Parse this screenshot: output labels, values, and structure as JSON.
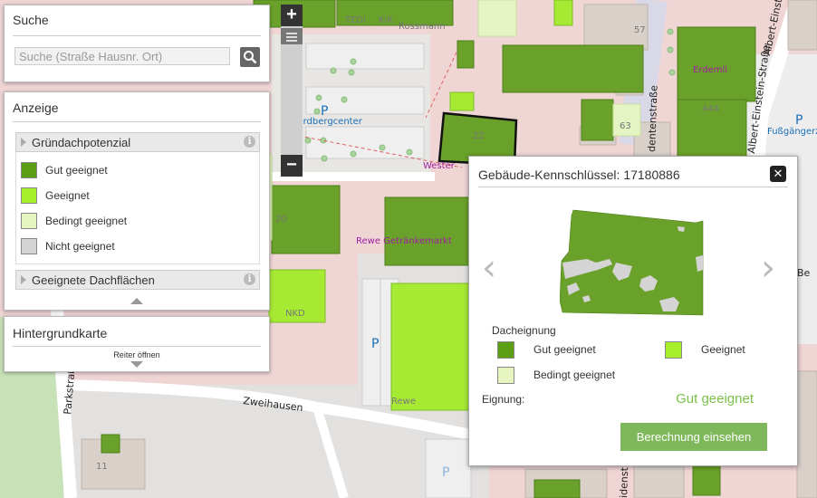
{
  "search": {
    "title": "Suche",
    "placeholder": "Suche (Straße Hausnr. Ort)"
  },
  "display": {
    "title": "Anzeige",
    "layer1": {
      "label": "Gründachpotenzial"
    },
    "legend": [
      {
        "label": "Gut geeignet",
        "color": "#5c9e14"
      },
      {
        "label": "Geeignet",
        "color": "#a6ef2a"
      },
      {
        "label": "Bedingt geeignet",
        "color": "#e6f5c0"
      },
      {
        "label": "Nicht geeignet",
        "color": "#d4d4d4"
      }
    ],
    "layer2": {
      "label": "Geeignete Dachflächen"
    }
  },
  "background": {
    "title": "Hintergrundkarte",
    "open_label": "Reiter öffnen"
  },
  "zoom": {
    "in": "+",
    "out": "−"
  },
  "info": {
    "title": "Gebäude-Kennschlüssel: 17180886",
    "close": "✕",
    "suitability_title": "Dacheignung",
    "legend": [
      {
        "label": "Gut geeignet",
        "color": "#5c9e14"
      },
      {
        "label": "Geeignet",
        "color": "#a6ef2a"
      },
      {
        "label": "Bedingt geeignet",
        "color": "#e6f5c0"
      }
    ],
    "result_label": "Eignung:",
    "result_value": "Gut geeignet",
    "button": "Berechnung einsehen"
  },
  "map": {
    "streets": [
      "Zweihausen",
      "Parkstraße",
      "Albert-Einst",
      "Albert-Einstein-Straße",
      "dentenstraße",
      "idenst"
    ],
    "pois": [
      "Nordbergcenter",
      "Fußgängerz",
      "Rewe Getränkemarkt",
      "Wester",
      "Erdemli",
      "NKD",
      "Rewe",
      "Rossmann",
      "TEDi",
      "KiK"
    ],
    "parking": "P",
    "house_numbers": [
      "57",
      "63",
      "22",
      "20",
      "11",
      "444",
      "Be"
    ]
  }
}
